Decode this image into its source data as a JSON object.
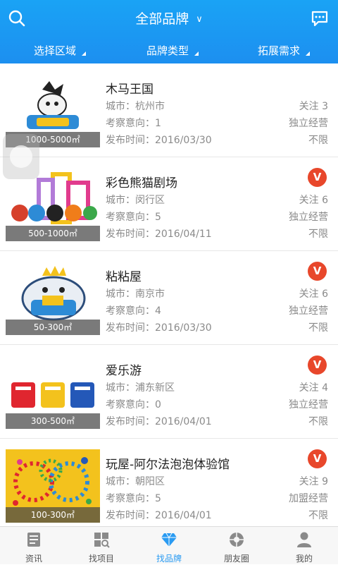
{
  "header": {
    "title": "全部品牌",
    "filters": [
      "选择区域",
      "品牌类型",
      "拓展需求"
    ],
    "accent_color": "#1c8ff0"
  },
  "brands": [
    {
      "name": "木马王国",
      "city": "城市：杭州市",
      "intent": "考察意向：1",
      "date": "发布时间：2016/03/30",
      "follow": "关注 3",
      "mode": "独立经营",
      "limit": "不限",
      "area": "1000-5000㎡",
      "verified": false
    },
    {
      "name": "彩色熊猫剧场",
      "city": "城市：闵行区",
      "intent": "考察意向：5",
      "date": "发布时间：2016/04/11",
      "follow": "关注 6",
      "mode": "独立经营",
      "limit": "不限",
      "area": "500-1000㎡",
      "verified": true
    },
    {
      "name": "粘粘屋",
      "city": "城市：南京市",
      "intent": "考察意向：4",
      "date": "发布时间：2016/03/30",
      "follow": "关注 6",
      "mode": "独立经营",
      "limit": "不限",
      "area": "50-300㎡",
      "verified": true
    },
    {
      "name": "爱乐游",
      "city": "城市：浦东新区",
      "intent": "考察意向：0",
      "date": "发布时间：2016/04/01",
      "follow": "关注 4",
      "mode": "独立经营",
      "limit": "不限",
      "area": "300-500㎡",
      "verified": true
    },
    {
      "name": "玩屋-阿尔法泡泡体验馆",
      "city": "城市：朝阳区",
      "intent": "考察意向：5",
      "date": "发布时间：2016/04/01",
      "follow": "关注 9",
      "mode": "加盟经营",
      "limit": "不限",
      "area": "100-300㎡",
      "verified": true
    }
  ],
  "badge_label": "V",
  "tabs": [
    {
      "label": "资讯",
      "icon": "news-icon"
    },
    {
      "label": "找项目",
      "icon": "find-project-icon"
    },
    {
      "label": "找品牌",
      "icon": "diamond-icon",
      "active": true
    },
    {
      "label": "朋友圈",
      "icon": "moments-icon"
    },
    {
      "label": "我的",
      "icon": "profile-icon"
    }
  ]
}
